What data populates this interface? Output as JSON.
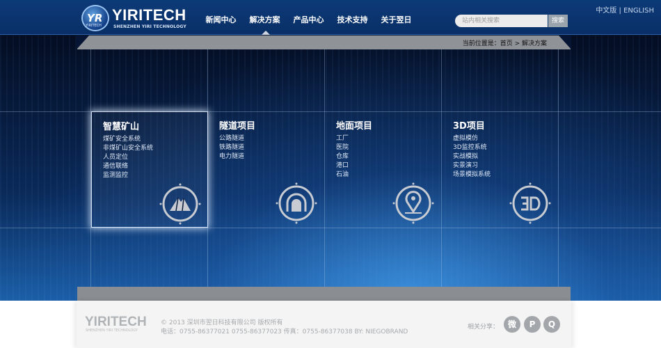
{
  "header": {
    "logo_badge": "YR",
    "logo_badge_sub": "YIRITECH",
    "brand": "YIRITECH",
    "brand_sub": "SHENZHEN YIRI TECHNOLOGY",
    "nav": [
      {
        "label": "新闻中心",
        "active": false
      },
      {
        "label": "解决方案",
        "active": true
      },
      {
        "label": "产品中心",
        "active": false
      },
      {
        "label": "技术支持",
        "active": false
      },
      {
        "label": "关于翌日",
        "active": false
      }
    ],
    "lang": {
      "zh": "中文版",
      "sep": "|",
      "en": "ENGLISH"
    },
    "search": {
      "placeholder": "站内相关搜索",
      "button": "搜索"
    }
  },
  "breadcrumb": "当前位置是：首页 > 解决方案",
  "panels": [
    {
      "title": "智慧矿山",
      "items": [
        "煤矿安全系统",
        "非煤矿山安全系统",
        "人员定位",
        "通信联络",
        "监测监控"
      ],
      "icon": "mountain-icon",
      "active": true
    },
    {
      "title": "隧道项目",
      "items": [
        "公路隧道",
        "铁路隧道",
        "电力隧道"
      ],
      "icon": "tunnel-icon",
      "active": false
    },
    {
      "title": "地面项目",
      "items": [
        "工厂",
        "医院",
        "仓库",
        "港口",
        "石油"
      ],
      "icon": "location-pin-icon",
      "active": false
    },
    {
      "title": "3D项目",
      "items": [
        "虚拟模仿",
        "3D监控系统",
        "实战模拟",
        "实景演习",
        "场景模拟系统"
      ],
      "icon": "3d-icon",
      "active": false
    }
  ],
  "footer": {
    "logo": "YIRITECH",
    "logo_sub": "SHENZHEN YIRI TECHNOLOGY",
    "copyright": "© 2013   深圳市翌日科技有限公司 版权所有",
    "contact": "电话：0755-86377021 0755-86377023  传真：0755-86377038   BY: NIEGOBRAND",
    "share_label": "相关分享：",
    "share_icons": [
      {
        "name": "weibo-icon",
        "glyph": "微"
      },
      {
        "name": "tencent-weibo-icon",
        "glyph": "P"
      },
      {
        "name": "qq-icon",
        "glyph": "Q"
      }
    ]
  },
  "colors": {
    "header_bg": "#0c3a78",
    "bar_gray": "#8f9398",
    "footer_bg": "#f4f4f4",
    "icon_gray": "#a3a6aa"
  }
}
